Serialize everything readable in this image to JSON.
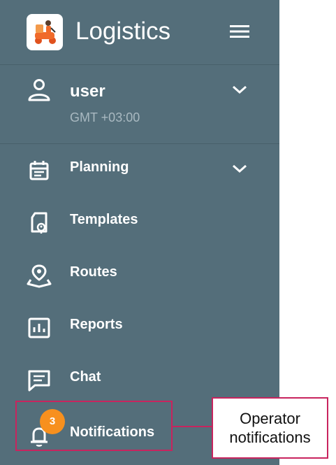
{
  "header": {
    "title": "Logistics"
  },
  "user": {
    "name": "user",
    "timezone": "GMT +03:00"
  },
  "nav": {
    "planning": "Planning",
    "templates": "Templates",
    "routes": "Routes",
    "reports": "Reports",
    "chat": "Chat",
    "notifications": "Notifications"
  },
  "notifications_badge": "3",
  "callout": {
    "text": "Operator notifications"
  },
  "colors": {
    "sidebar": "#546e7a",
    "badge": "#f7901e",
    "highlight": "#c8245e"
  },
  "icons": [
    "logo-icon",
    "menu-icon",
    "user-icon",
    "chevron-down-icon",
    "calendar-icon",
    "template-icon",
    "route-icon",
    "chart-icon",
    "chat-icon",
    "bell-icon"
  ]
}
